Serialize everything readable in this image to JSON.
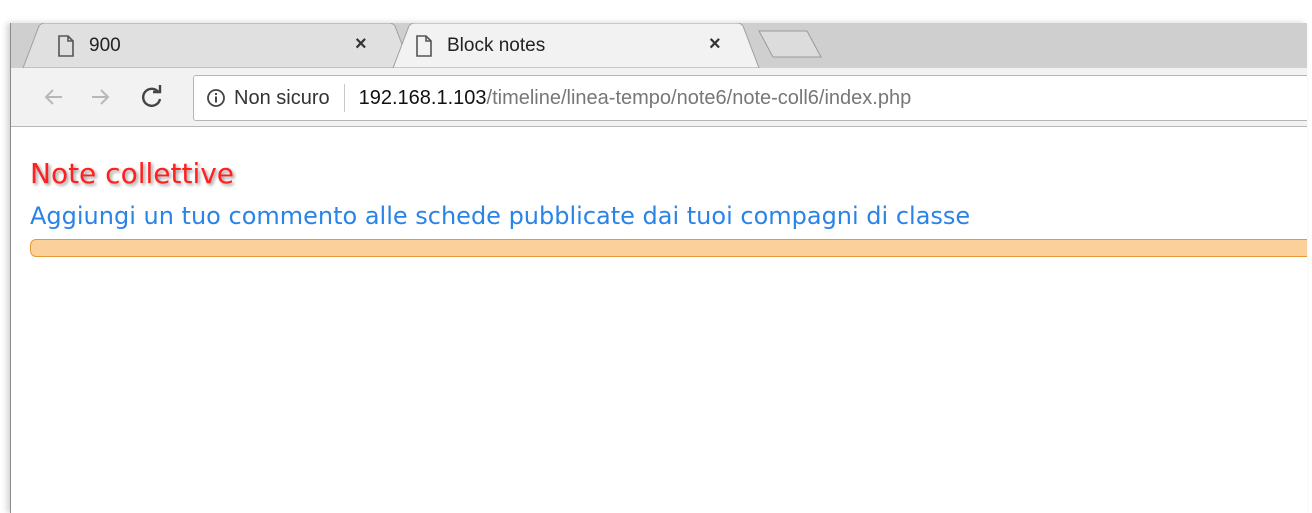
{
  "browser": {
    "tabs": [
      {
        "title": "900",
        "icon": "document-icon",
        "active": false
      },
      {
        "title": "Block notes",
        "icon": "document-icon",
        "active": true
      }
    ],
    "close_glyph": "×",
    "new_tab_icon": "new-tab-icon"
  },
  "toolbar": {
    "back_icon": "back-arrow-icon",
    "forward_icon": "forward-arrow-icon",
    "reload_icon": "reload-icon",
    "security_label": "Non sicuro",
    "url_host": "192.168.1.103",
    "url_path": "/timeline/linea-tempo/note6/note-coll6/index.php"
  },
  "page": {
    "title": "Note collettive",
    "subtitle": "Aggiungi un tuo commento alle schede pubblicate dai tuoi compagni di classe"
  },
  "colors": {
    "title": "#ff2020",
    "subtitle": "#2a84e8",
    "bar_fill": "#fbd09b",
    "bar_border": "#e59a3a",
    "tabstrip": "#cfcfcf",
    "active_tab": "#f2f2f2"
  }
}
